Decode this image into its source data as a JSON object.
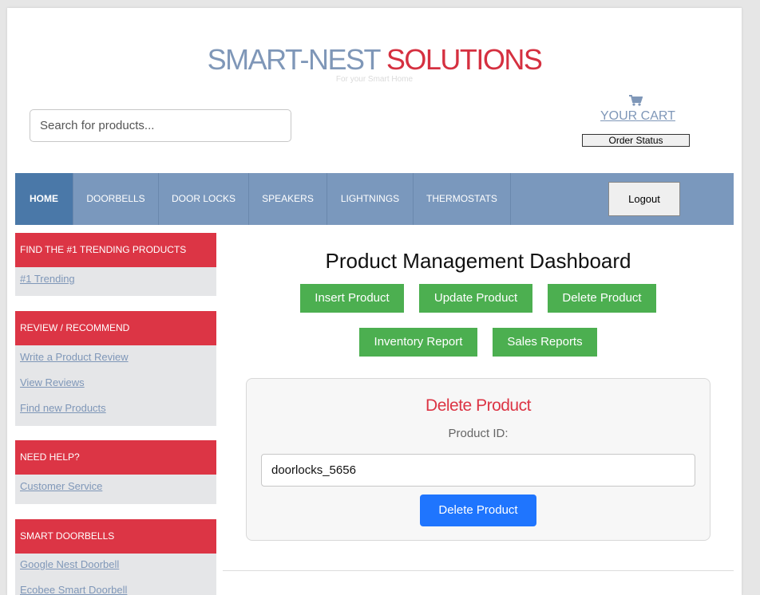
{
  "brand": {
    "part1": "SMART-NEST ",
    "part2": "SOLUTIONS",
    "tagline": "For your Smart Home"
  },
  "search": {
    "placeholder": "Search for products..."
  },
  "cart": {
    "label": "YOUR CART",
    "icon": "cart-icon",
    "order_status": "Order Status"
  },
  "nav": {
    "items": [
      {
        "label": "HOME"
      },
      {
        "label": "DOORBELLS"
      },
      {
        "label": "DOOR LOCKS"
      },
      {
        "label": "SPEAKERS"
      },
      {
        "label": "LIGHTNINGS"
      },
      {
        "label": "THERMOSTATS"
      }
    ],
    "logout": "Logout"
  },
  "sidebar": {
    "sections": [
      {
        "title": "FIND THE #1 TRENDING PRODUCTS",
        "links": [
          "#1 Trending"
        ]
      },
      {
        "title": "REVIEW / RECOMMEND",
        "links": [
          "Write a Product Review",
          "View Reviews",
          "Find new Products"
        ]
      },
      {
        "title": "NEED HELP?",
        "links": [
          "Customer Service"
        ]
      },
      {
        "title": "SMART DOORBELLS",
        "links": [
          "Google Nest Doorbell",
          "Ecobee Smart Doorbell"
        ]
      }
    ]
  },
  "dashboard": {
    "title": "Product Management Dashboard",
    "buttons": [
      "Insert Product",
      "Update Product",
      "Delete Product",
      "Inventory Report",
      "Sales Reports"
    ]
  },
  "delete_form": {
    "title": "Delete Product",
    "label": "Product ID:",
    "value": "doorlocks_5656",
    "submit": "Delete Product"
  },
  "colors": {
    "nav_bg": "#7a98bd",
    "nav_active": "#4a78a8",
    "accent_red": "#dc3545",
    "green": "#4caf50",
    "blue": "#1f75fe",
    "brand_blue": "#7f97b8"
  }
}
